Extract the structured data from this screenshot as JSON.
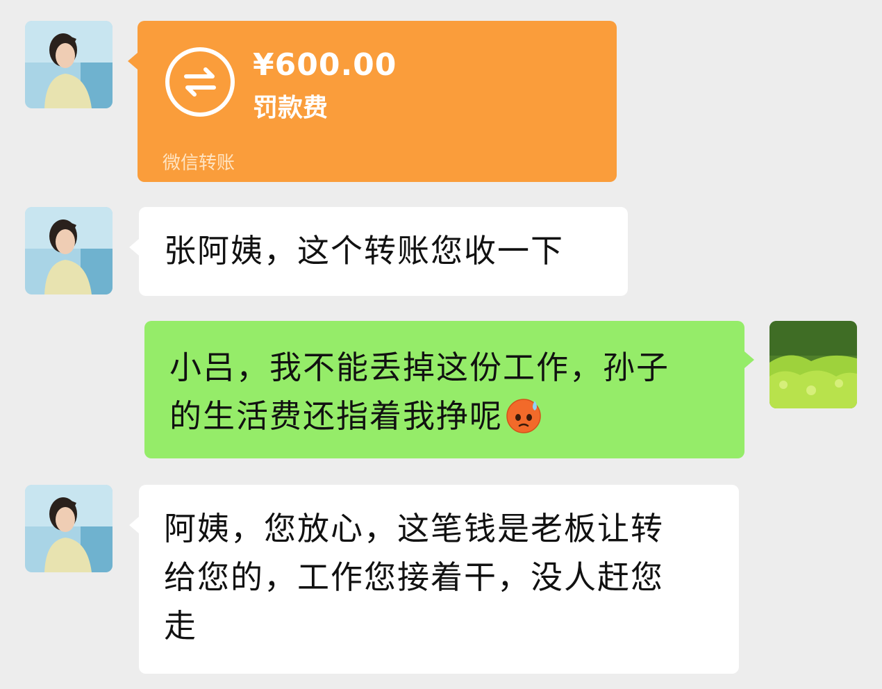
{
  "colors": {
    "background": "#ededed",
    "incoming_bubble": "#ffffff",
    "outgoing_bubble": "#95ec69",
    "transfer_card": "#fa9d3b"
  },
  "messages": [
    {
      "sender": "other",
      "type": "transfer",
      "amount": "¥600.00",
      "memo": "罚款费",
      "footer": "微信转账",
      "icon": "transfer-arrows-icon"
    },
    {
      "sender": "other",
      "type": "text",
      "text": "张阿姨，这个转账您收一下"
    },
    {
      "sender": "me",
      "type": "text",
      "lines": [
        "小吕，我不能丢掉这份工作，孙子",
        "的生活费还指着我挣呢"
      ],
      "emoji": "anxious-sweat-emoji"
    },
    {
      "sender": "other",
      "type": "text",
      "lines": [
        "阿姨，您放心，这笔钱是老板让转",
        "给您的，工作您接着干，没人赶您",
        "走"
      ]
    }
  ]
}
